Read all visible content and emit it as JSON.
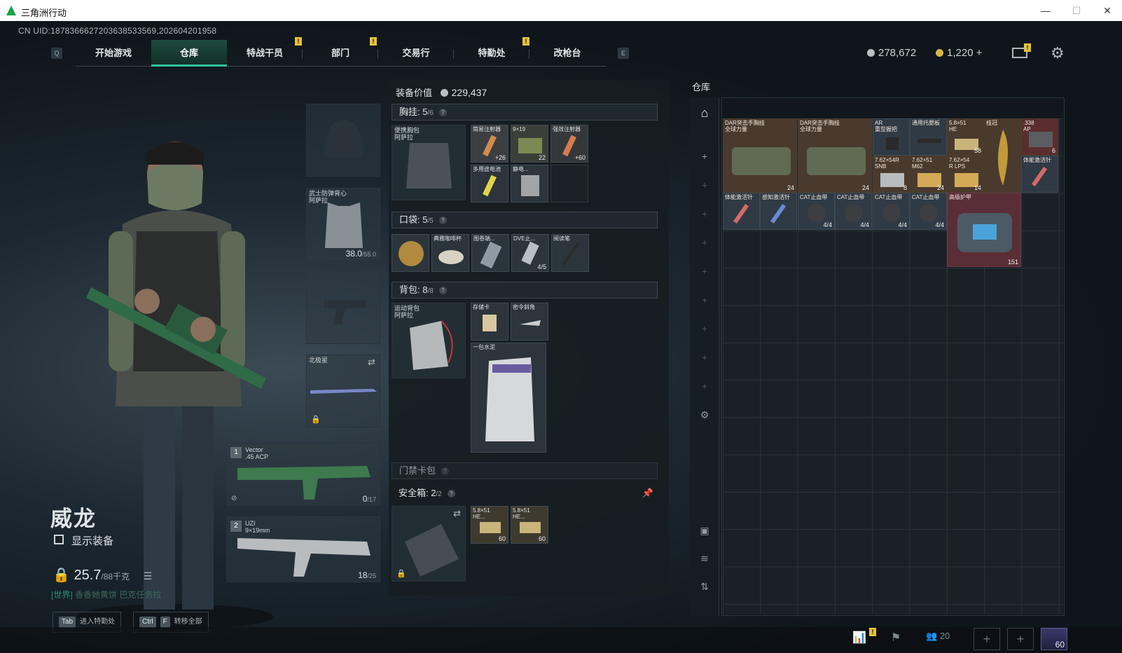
{
  "window": {
    "title": "三角洲行动",
    "controls": [
      "—",
      "☐",
      "✕"
    ]
  },
  "uid": "CN UID:18783666272036385335​69,202604201958",
  "nav": {
    "left_key": "Q",
    "right_key": "E",
    "tabs": [
      "开始游戏",
      "仓库",
      "特战干员",
      "部门",
      "交易行",
      "特勤处",
      "改枪台"
    ],
    "active": "仓库",
    "badges": [
      "!",
      "!",
      "!"
    ]
  },
  "currency": {
    "silver": "278,672",
    "gold": "1,220",
    "plus": "+",
    "mail_badge": "!"
  },
  "character": {
    "name": "威龙",
    "show_equipment": "显示装备",
    "weight": "25.7",
    "weight_max": "/88千克",
    "chat_channel": "[世界]",
    "chat_text": "香香她黄饼  巴克任务拉"
  },
  "hints": [
    {
      "keys": [
        "Tab"
      ],
      "label": "进入特勤处"
    },
    {
      "keys": [
        "Ctrl",
        "F"
      ],
      "label": "转移全部"
    }
  ],
  "slots": {
    "armor": {
      "label": "武士防弹背心\n阿萨拉",
      "durability": "38.0",
      "durability_max": "/55.0"
    },
    "melee": {
      "label": "北极星"
    },
    "primary": {
      "num": "1",
      "label": "Vector\n.45 ACP",
      "ammo": "0",
      "ammo_max": "/17"
    },
    "secondary": {
      "num": "2",
      "label": "UZI\n9×19mm",
      "ammo": "18",
      "ammo_max": "/25"
    }
  },
  "mid": {
    "value_label": "装备价值",
    "value": "229,437",
    "sections": {
      "chest": {
        "label": "胸挂:",
        "count": "5",
        "max": "/6"
      },
      "pocket": {
        "label": "口袋:",
        "count": "5",
        "max": "/5"
      },
      "backpack": {
        "label": "背包:",
        "count": "8",
        "max": "/8"
      },
      "keycard": {
        "label": "门禁卡包"
      },
      "safebox": {
        "label": "安全箱:",
        "count": "2",
        "max": "/2"
      }
    },
    "chest_rig": {
      "label": "便携胸包\n阿萨拉"
    },
    "chest_items": [
      {
        "name": "简易注射器",
        "count": "+26"
      },
      {
        "name": "9×19",
        "count": "22"
      },
      {
        "name": "强效注射器",
        "count": "+60"
      },
      {
        "name": "多用途电池",
        "count": ""
      },
      {
        "name": "静电...",
        "count": ""
      }
    ],
    "pocket_items": [
      {
        "name": "",
        "count": ""
      },
      {
        "name": "典雅咖啡杯",
        "count": ""
      },
      {
        "name": "图卷端...",
        "count": ""
      },
      {
        "name": "DVE止...",
        "count": "4/5"
      },
      {
        "name": "阅读笔",
        "count": ""
      }
    ],
    "backpack_bag": {
      "label": "运动背包\n阿萨拉"
    },
    "backpack_items": [
      {
        "name": "存储卡",
        "count": ""
      },
      {
        "name": "密令斜角",
        "count": ""
      },
      {
        "name": "一包水泥",
        "count": ""
      }
    ],
    "safebox_items": [
      {
        "name": "5.8×51\nHE...",
        "count": "60"
      },
      {
        "name": "5.8×51\nHE...",
        "count": "60"
      }
    ]
  },
  "warehouse": {
    "title": "仓库",
    "items": [
      {
        "name": "DAR突击手胸挂\n全球力量",
        "count": "24"
      },
      {
        "name": "DAR突击手胸挂\n全球力量",
        "count": "24"
      },
      {
        "name": "AR\n重型握把",
        "count": ""
      },
      {
        "name": "通用托腮板",
        "count": ""
      },
      {
        "name": "5.8×51\nHE",
        "count": "58"
      },
      {
        "name": "桂冠",
        "count": ""
      },
      {
        "name": ".338\nAP",
        "count": "6"
      },
      {
        "name": "7.62×54R\nSNB",
        "count": "8"
      },
      {
        "name": "7.62×51\nM62",
        "count": "24"
      },
      {
        "name": "7.62×54\nR LPS",
        "count": "14"
      },
      {
        "name": "体能激活针",
        "count": ""
      },
      {
        "name": "体能激活针",
        "count": ""
      },
      {
        "name": "感知激活针",
        "count": ""
      },
      {
        "name": "CAT止血带",
        "count": "4/4"
      },
      {
        "name": "CAT止血带",
        "count": "4/4"
      },
      {
        "name": "CAT止血带",
        "count": "4/4"
      },
      {
        "name": "CAT止血带",
        "count": "4/4"
      },
      {
        "name": "高级护甲",
        "count": "151"
      }
    ]
  },
  "bottom": {
    "squad_count": "20",
    "level": "60",
    "badge": "!"
  }
}
